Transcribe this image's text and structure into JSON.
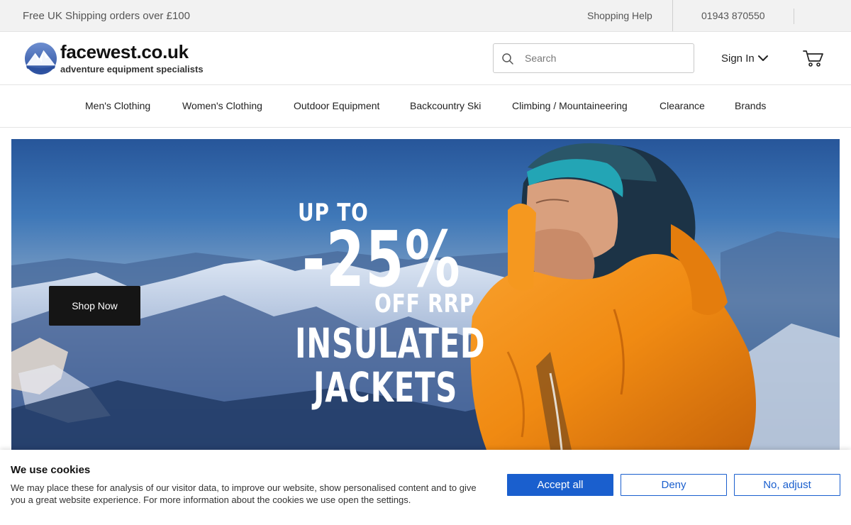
{
  "topbar": {
    "promo": "Free UK Shipping orders over £100",
    "help": "Shopping Help",
    "phone": "01943 870550"
  },
  "header": {
    "logo_name": "facewest.co.uk",
    "logo_tagline": "adventure equipment specialists",
    "search_placeholder": "Search",
    "signin_label": "Sign In",
    "icons": {
      "search": "search-icon",
      "signin": "chevron-down-icon",
      "cart": "cart-icon"
    }
  },
  "nav": {
    "items": [
      {
        "label": "Men's Clothing"
      },
      {
        "label": "Women's Clothing"
      },
      {
        "label": "Outdoor Equipment"
      },
      {
        "label": "Backcountry Ski"
      },
      {
        "label": "Climbing / Mountaineering"
      },
      {
        "label": "Clearance"
      },
      {
        "label": "Brands"
      }
    ]
  },
  "hero": {
    "line1": "UP TO",
    "line2": "-25%",
    "line3": "OFF RRP",
    "line4": "INSULATED",
    "line5": "JACKETS",
    "cta": "Shop Now"
  },
  "cookie": {
    "title": "We use cookies",
    "body": "We may place these for analysis of our visitor data, to improve our website, show personalised content and to give you a great website experience. For more information about the cookies we use open the settings.",
    "accept": "Accept all",
    "deny": "Deny",
    "adjust": "No, adjust",
    "accent_color": "#1a5fce"
  }
}
